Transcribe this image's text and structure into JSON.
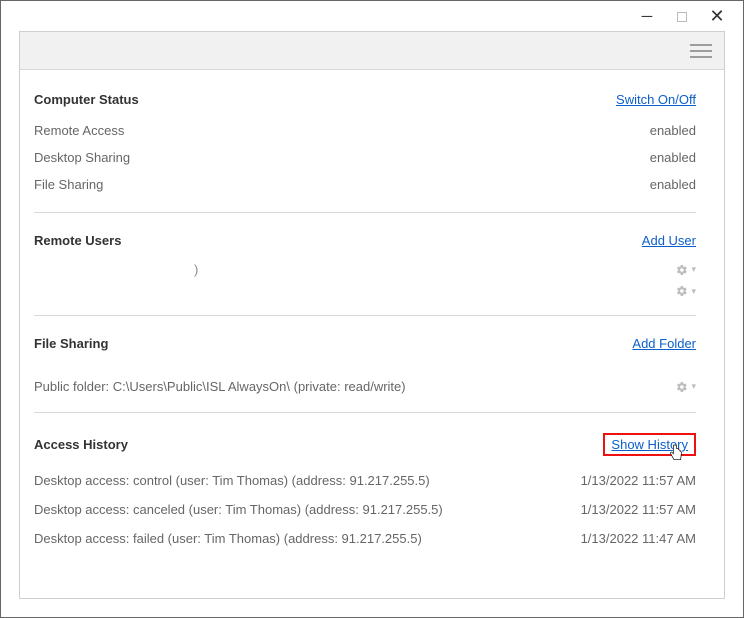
{
  "window": {},
  "sections": {
    "computerStatus": {
      "title": "Computer Status",
      "switchLink": "Switch On/Off",
      "rows": [
        {
          "label": "Remote Access",
          "value": "enabled"
        },
        {
          "label": "Desktop Sharing",
          "value": "enabled"
        },
        {
          "label": "File Sharing",
          "value": "enabled"
        }
      ]
    },
    "remoteUsers": {
      "title": "Remote Users",
      "addLink": "Add User",
      "rows": [
        {
          "name": "",
          "suffix": ")"
        },
        {
          "name": ""
        }
      ]
    },
    "fileSharing": {
      "title": "File Sharing",
      "addLink": "Add Folder",
      "path": "Public folder: C:\\Users\\Public\\ISL AlwaysOn\\ (private: read/write)"
    },
    "accessHistory": {
      "title": "Access History",
      "showLink": "Show History",
      "rows": [
        {
          "text": "Desktop access: control (user: Tim Thomas) (address: 91.217.255.5)",
          "time": "1/13/2022 11:57 AM"
        },
        {
          "text": "Desktop access: canceled (user: Tim Thomas) (address: 91.217.255.5)",
          "time": "1/13/2022 11:57 AM"
        },
        {
          "text": "Desktop access: failed (user: Tim Thomas) (address: 91.217.255.5)",
          "time": "1/13/2022 11:47 AM"
        }
      ]
    }
  }
}
